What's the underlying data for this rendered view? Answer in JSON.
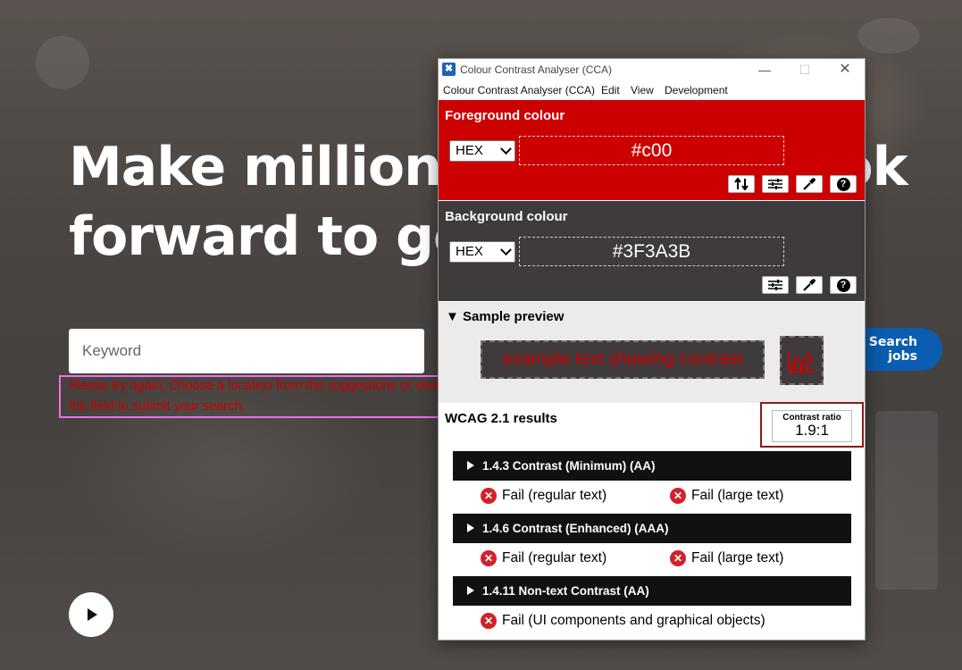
{
  "page": {
    "hero_line1": "Make millions of people look",
    "hero_line2": "forward to going to work",
    "keyword_placeholder": "Keyword",
    "error_message": "Please try again. Choose a location from the suggestions or clear the field to submit your search.",
    "search_button": "Search jobs"
  },
  "window": {
    "title": "Colour Contrast Analyser (CCA)",
    "menu": [
      "Colour Contrast Analyser (CCA)",
      "Edit",
      "View",
      "Development"
    ]
  },
  "foreground": {
    "label": "Foreground colour",
    "format": "HEX",
    "value": "#c00",
    "color": "#cc0000"
  },
  "background": {
    "label": "Background colour",
    "format": "HEX",
    "value": "#3F3A3B",
    "color": "#3f3a3b"
  },
  "preview": {
    "heading": "Sample preview",
    "sample_text": "example text showing contrast"
  },
  "wcag": {
    "title": "WCAG 2.1 results",
    "ratio_label": "Contrast ratio",
    "ratio_value": "1.9:1",
    "criteria": [
      {
        "name": "1.4.3 Contrast (Minimum) (AA)",
        "results": [
          "Fail (regular text)",
          "Fail (large text)"
        ]
      },
      {
        "name": "1.4.6 Contrast (Enhanced) (AAA)",
        "results": [
          "Fail (regular text)",
          "Fail (large text)"
        ]
      },
      {
        "name": "1.4.11 Non-text Contrast (AA)",
        "results": [
          "Fail (UI components and graphical objects)"
        ]
      }
    ]
  },
  "icons": {
    "app": "cca-app-icon",
    "swap": "swap-arrows-icon",
    "sliders": "sliders-icon",
    "picker": "eyedropper-icon",
    "help": "help-icon",
    "fail": "fail-x-icon",
    "play": "play-icon"
  }
}
